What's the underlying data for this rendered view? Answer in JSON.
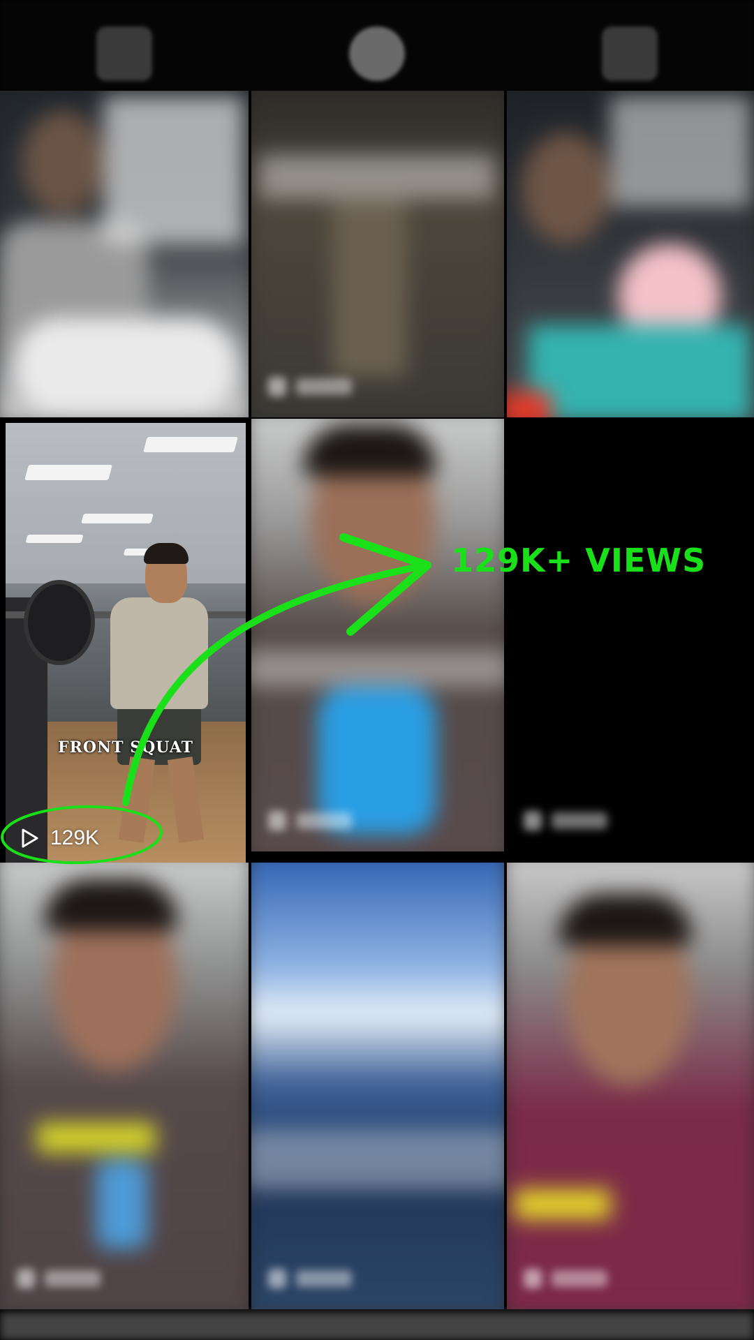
{
  "tabs": [
    {
      "icon": "grid-icon"
    },
    {
      "icon": "reels-icon"
    },
    {
      "icon": "tagged-icon"
    }
  ],
  "featured": {
    "caption": "FRONT SQUAT",
    "views": "129K",
    "icon": "play-icon"
  },
  "annotation": {
    "callout": "129K+ VIEWS",
    "color": "#19e019"
  },
  "colors": {
    "accent": "#19e019",
    "background": "#000000"
  }
}
